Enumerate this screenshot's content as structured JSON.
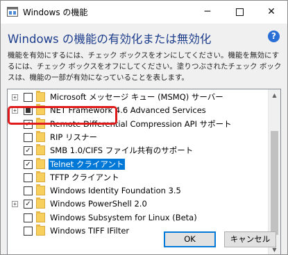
{
  "window": {
    "title": "Windows の機能",
    "minimize": "─",
    "close": "✕"
  },
  "heading": "Windows の機能の有効化または無効化",
  "help_symbol": "?",
  "description": "機能を有効にするには、チェック ボックスをオンにしてください。機能を無効にするには、チェック ボックスをオフにしてください。塗りつぶされたチェック ボックスは、機能の一部が有効になっていることを表します。",
  "features": [
    {
      "label": "Microsoft メッセージ キュー (MSMQ) サーバー",
      "state": "unchecked",
      "expandable": true
    },
    {
      "label": "NET Framework 4.6 Advanced Services",
      "state": "partial",
      "expandable": true
    },
    {
      "label": "Remote Differential Compression API サポート",
      "state": "checked",
      "expandable": false
    },
    {
      "label": "RIP リスナー",
      "state": "unchecked",
      "expandable": false
    },
    {
      "label": "SMB 1.0/CIFS ファイル共有のサポート",
      "state": "checked",
      "expandable": false
    },
    {
      "label": "Telnet クライアント",
      "state": "checked",
      "expandable": false,
      "selected": true
    },
    {
      "label": "TFTP クライアント",
      "state": "unchecked",
      "expandable": false
    },
    {
      "label": "Windows Identity Foundation 3.5",
      "state": "unchecked",
      "expandable": false
    },
    {
      "label": "Windows PowerShell 2.0",
      "state": "checked",
      "expandable": true
    },
    {
      "label": "Windows Subsystem for Linux (Beta)",
      "state": "unchecked",
      "expandable": false
    },
    {
      "label": "Windows TIFF IFilter",
      "state": "unchecked",
      "expandable": false
    }
  ],
  "buttons": {
    "ok": "OK",
    "cancel": "キャンセル"
  },
  "colors": {
    "heading": "#1c3c8c",
    "selection": "#0078d7",
    "highlight_box": "#e01a1a"
  }
}
